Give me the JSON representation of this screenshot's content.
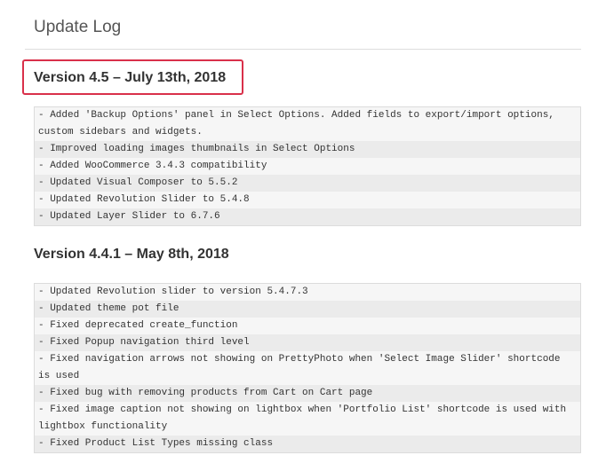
{
  "page": {
    "title": "Update Log"
  },
  "versions": [
    {
      "heading": "Version 4.5 – July 13th, 2018",
      "highlighted": true,
      "highlight_color": "#d9304a",
      "entries": [
        "- Added 'Backup Options' panel in Select Options. Added fields to export/import options, custom sidebars and widgets.",
        "- Improved loading images thumbnails in Select Options",
        "- Added WooCommerce 3.4.3 compatibility",
        "- Updated Visual Composer to 5.5.2",
        "- Updated Revolution Slider to 5.4.8",
        "- Updated Layer Slider to 6.7.6"
      ]
    },
    {
      "heading": "Version 4.4.1 – May 8th, 2018",
      "highlighted": false,
      "entries": [
        "- Updated Revolution slider to version 5.4.7.3",
        "- Updated theme pot file",
        "- Fixed deprecated create_function",
        "- Fixed Popup navigation third level",
        "- Fixed navigation arrows not showing on PrettyPhoto when 'Select Image Slider' shortcode is used",
        "- Fixed bug with removing products from Cart on Cart page",
        "- Fixed image caption not showing on lightbox when 'Portfolio List' shortcode is used with lightbox functionality",
        "- Fixed Product List Types missing class"
      ]
    }
  ]
}
